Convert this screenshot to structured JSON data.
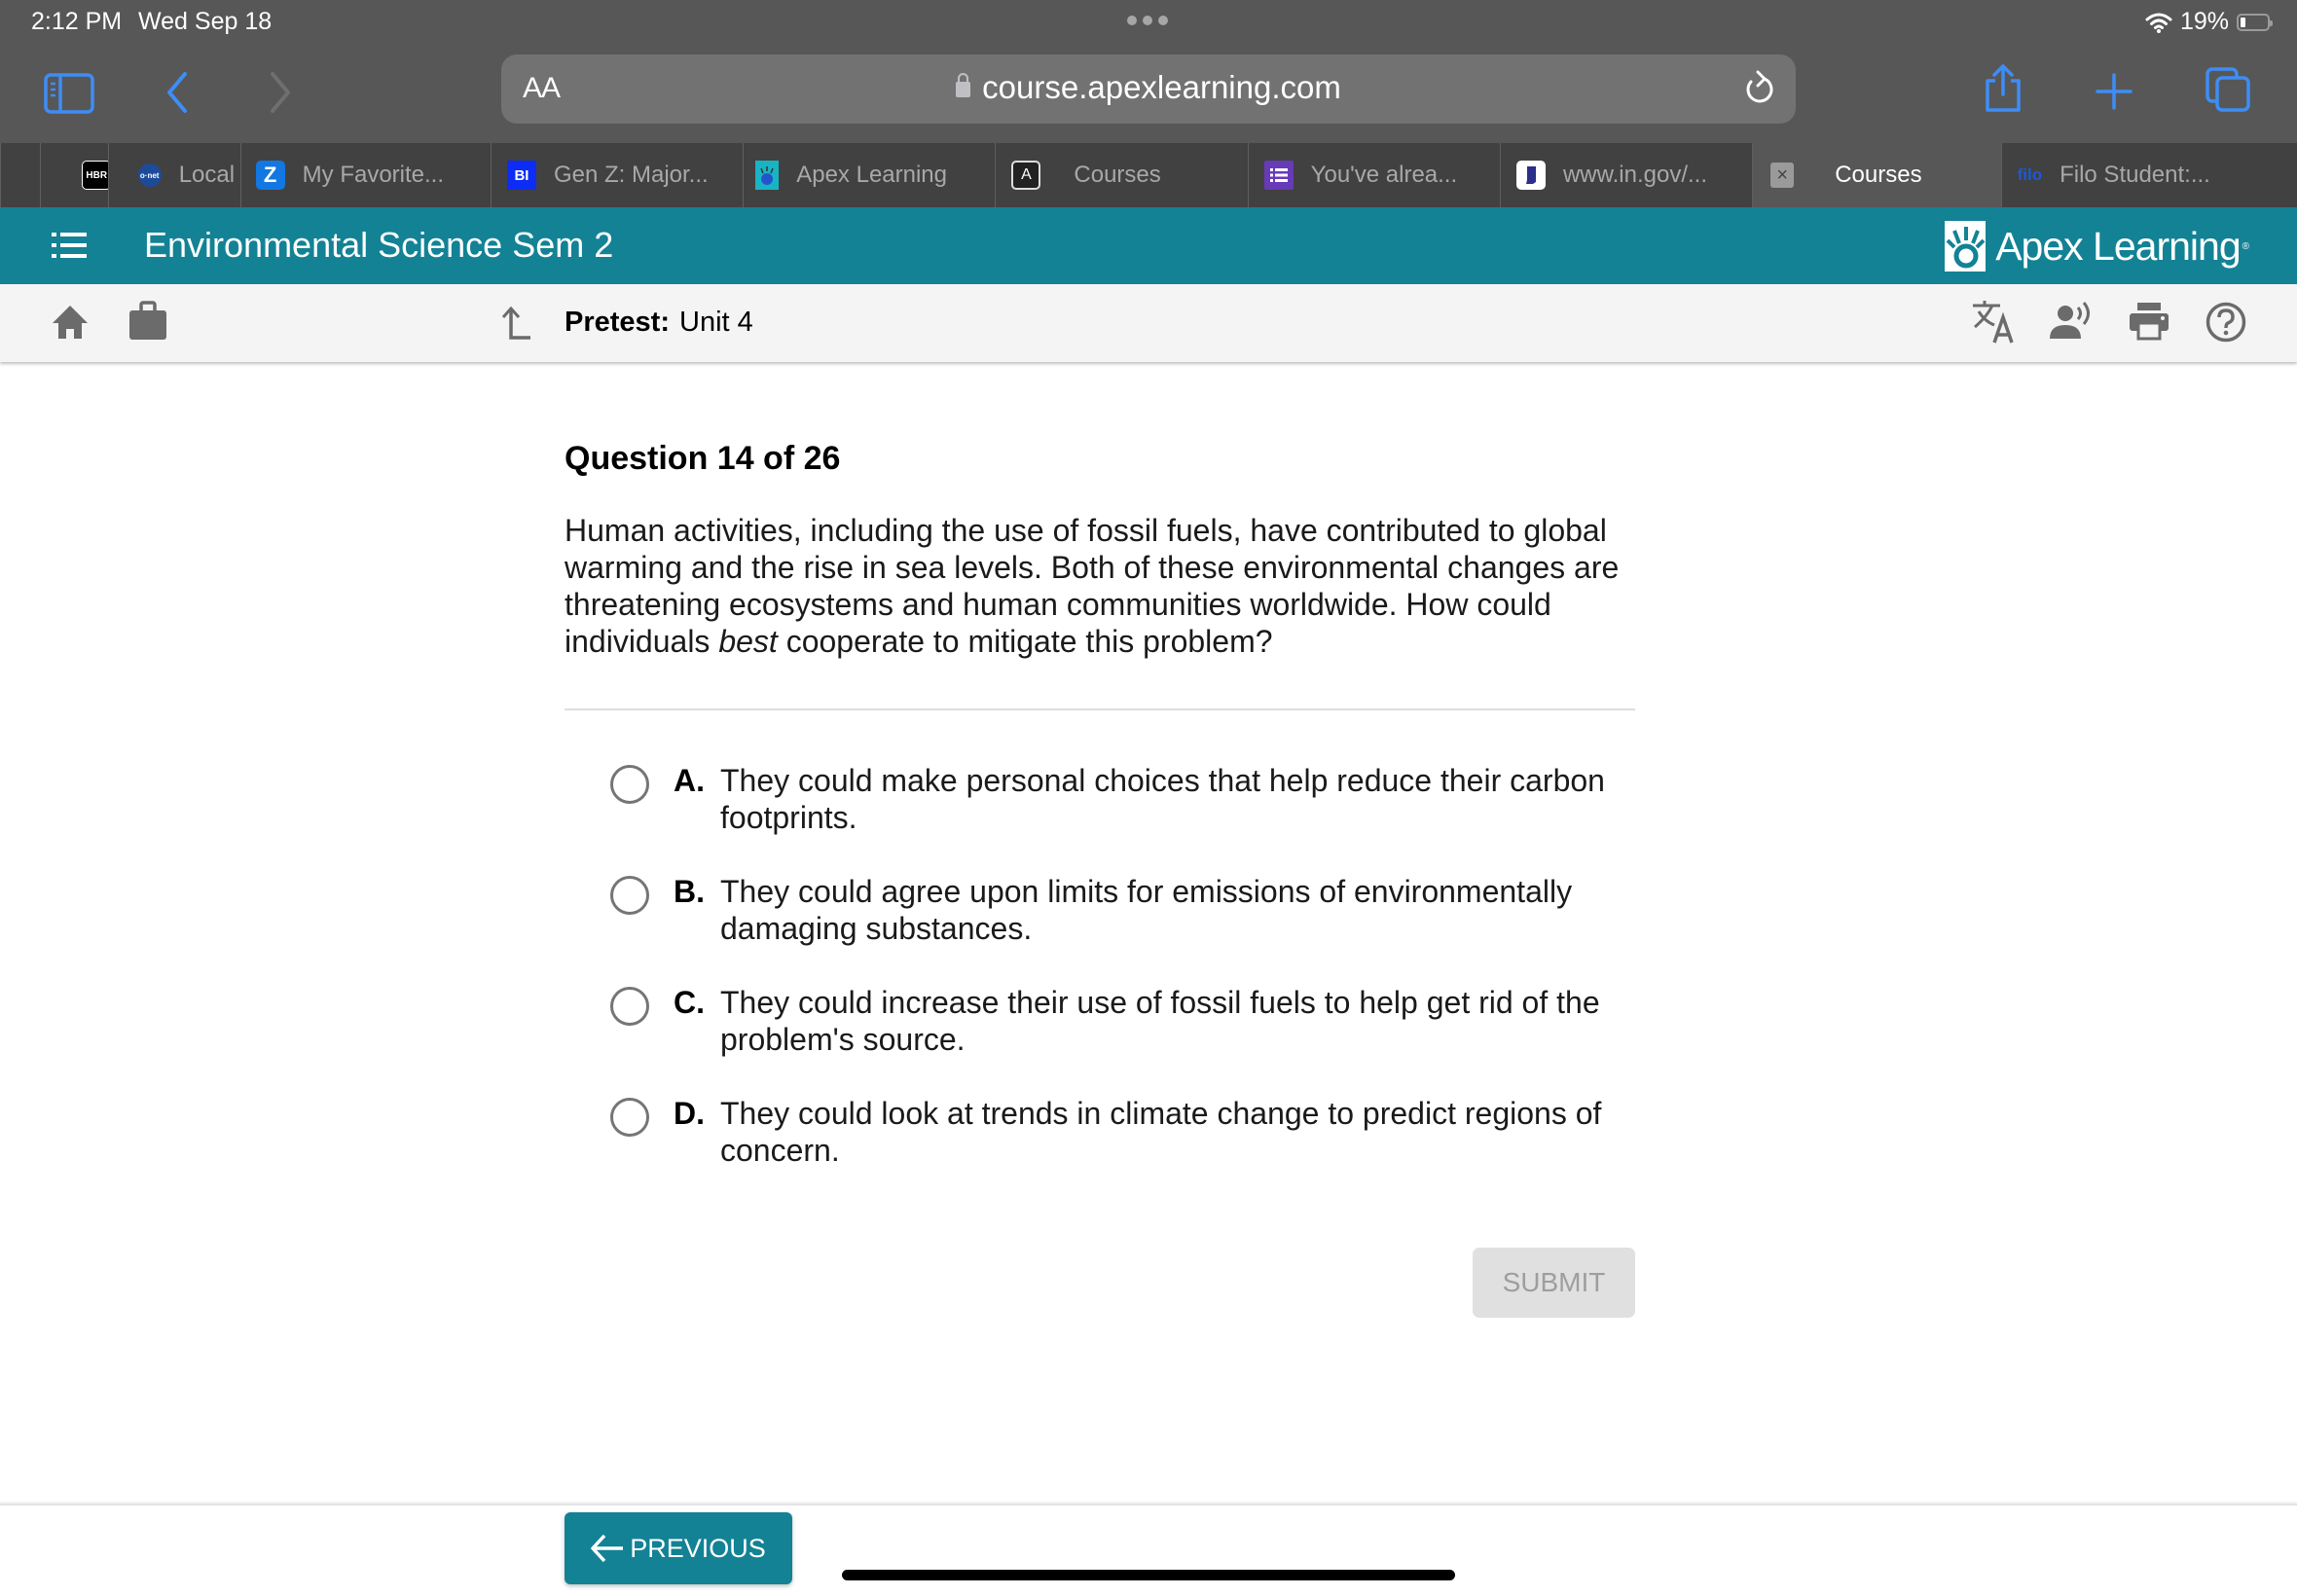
{
  "status_bar": {
    "time": "2:12 PM",
    "date": "Wed Sep 18",
    "wifi_icon": "wifi-icon",
    "battery_percent": "19%",
    "battery_level": 0.19
  },
  "browser": {
    "text_size_button": "AA",
    "url": "course.apexlearning.com",
    "icons": [
      "sidebar-icon",
      "back-icon",
      "forward-icon",
      "lock-icon",
      "reload-icon",
      "share-icon",
      "new-tab-icon",
      "tabs-icon"
    ],
    "accent_color": "#3e8df5",
    "tabs": [
      {
        "label": "",
        "favicon": "HBR",
        "favicon_color": "#000000"
      },
      {
        "label": "Local",
        "favicon": "o net",
        "favicon_color": "#1d4b9a"
      },
      {
        "label": "My Favorite...",
        "favicon": "Z",
        "favicon_color": "#1277e1"
      },
      {
        "label": "Gen Z: Major...",
        "favicon": "BI",
        "favicon_color": "#0d2cf5"
      },
      {
        "label": "Apex Learning",
        "favicon": "apex",
        "favicon_color": "#19b4c4"
      },
      {
        "label": "Courses",
        "favicon": "A",
        "favicon_color": "#222222"
      },
      {
        "label": "You've alrea...",
        "favicon": "list",
        "favicon_color": "#673ab7"
      },
      {
        "label": "www.in.gov/...",
        "favicon": "IN",
        "favicon_color": "#ffffff"
      },
      {
        "label": "Courses",
        "favicon": "×",
        "favicon_color": "#9a9a9a",
        "active": true
      },
      {
        "label": "Filo Student:...",
        "favicon": "filo",
        "favicon_color": "#1a5ad6"
      }
    ]
  },
  "header": {
    "course_title": "Environmental Science Sem 2",
    "brand": "Apex Learning",
    "brand_color": "#138295"
  },
  "subbar": {
    "assessment_type": "Pretest:",
    "assessment_name": "Unit 4",
    "tools": [
      "translate-icon",
      "read-aloud-icon",
      "print-icon",
      "help-icon"
    ]
  },
  "question": {
    "title": "Question 14 of 26",
    "text_before": "Human activities, including the use of fossil fuels, have contributed to global warming and the rise in sea levels. Both of these environmental changes are threatening ecosystems and human communities worldwide. How could individuals ",
    "text_emphasis": "best",
    "text_after": " cooperate to mitigate this problem?",
    "options": [
      {
        "letter": "A.",
        "text": "They could make personal choices that help reduce their carbon footprints.",
        "selected": false
      },
      {
        "letter": "B.",
        "text": "They could agree upon limits for emissions of environmentally damaging substances.",
        "selected": false
      },
      {
        "letter": "C.",
        "text": "They could increase their use of fossil fuels to help get rid of the problem's source.",
        "selected": false
      },
      {
        "letter": "D.",
        "text": "They could look at trends in climate change to predict regions of concern.",
        "selected": false
      }
    ],
    "submit_label": "SUBMIT",
    "submit_enabled": false
  },
  "footer": {
    "previous_label": "PREVIOUS"
  }
}
